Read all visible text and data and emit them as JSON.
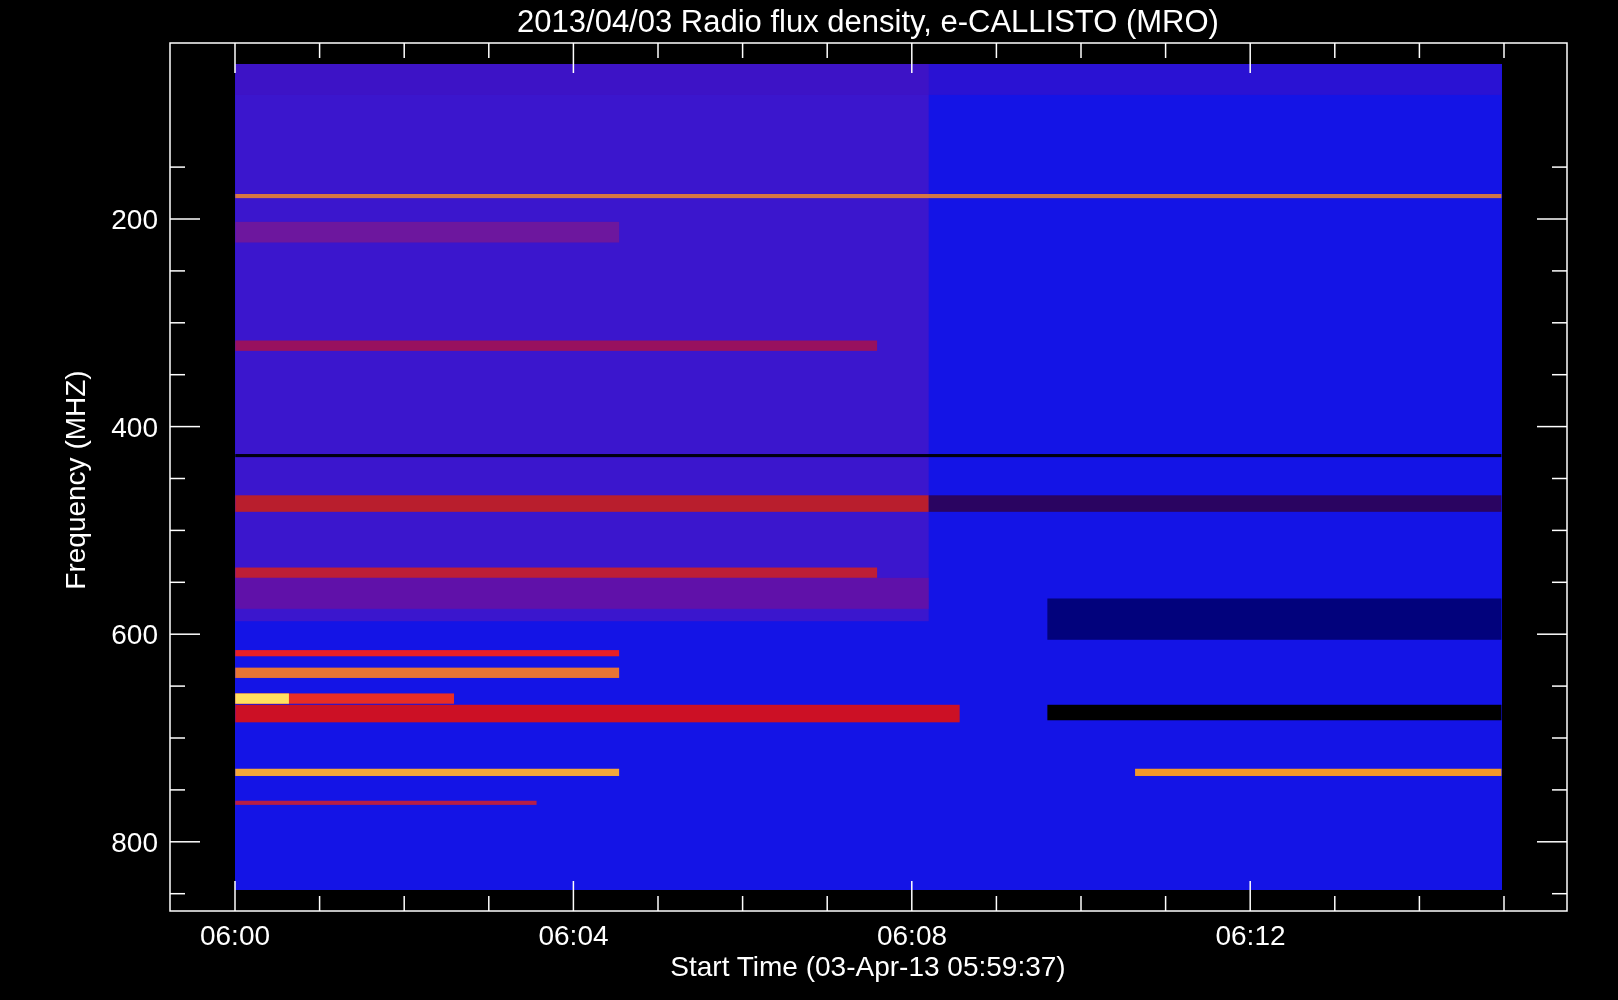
{
  "plot": {
    "title": "2013/04/03  Radio flux density, e-CALLISTO (MRO)",
    "ylabel": "Frequency (MHZ)",
    "yticks": [
      "200",
      "400",
      "600",
      "800"
    ],
    "xticks": [
      "06:00",
      "06:04",
      "06:08",
      "06:12"
    ],
    "xlabel": "Start Time (03-Apr-13 05:59:37)"
  }
}
